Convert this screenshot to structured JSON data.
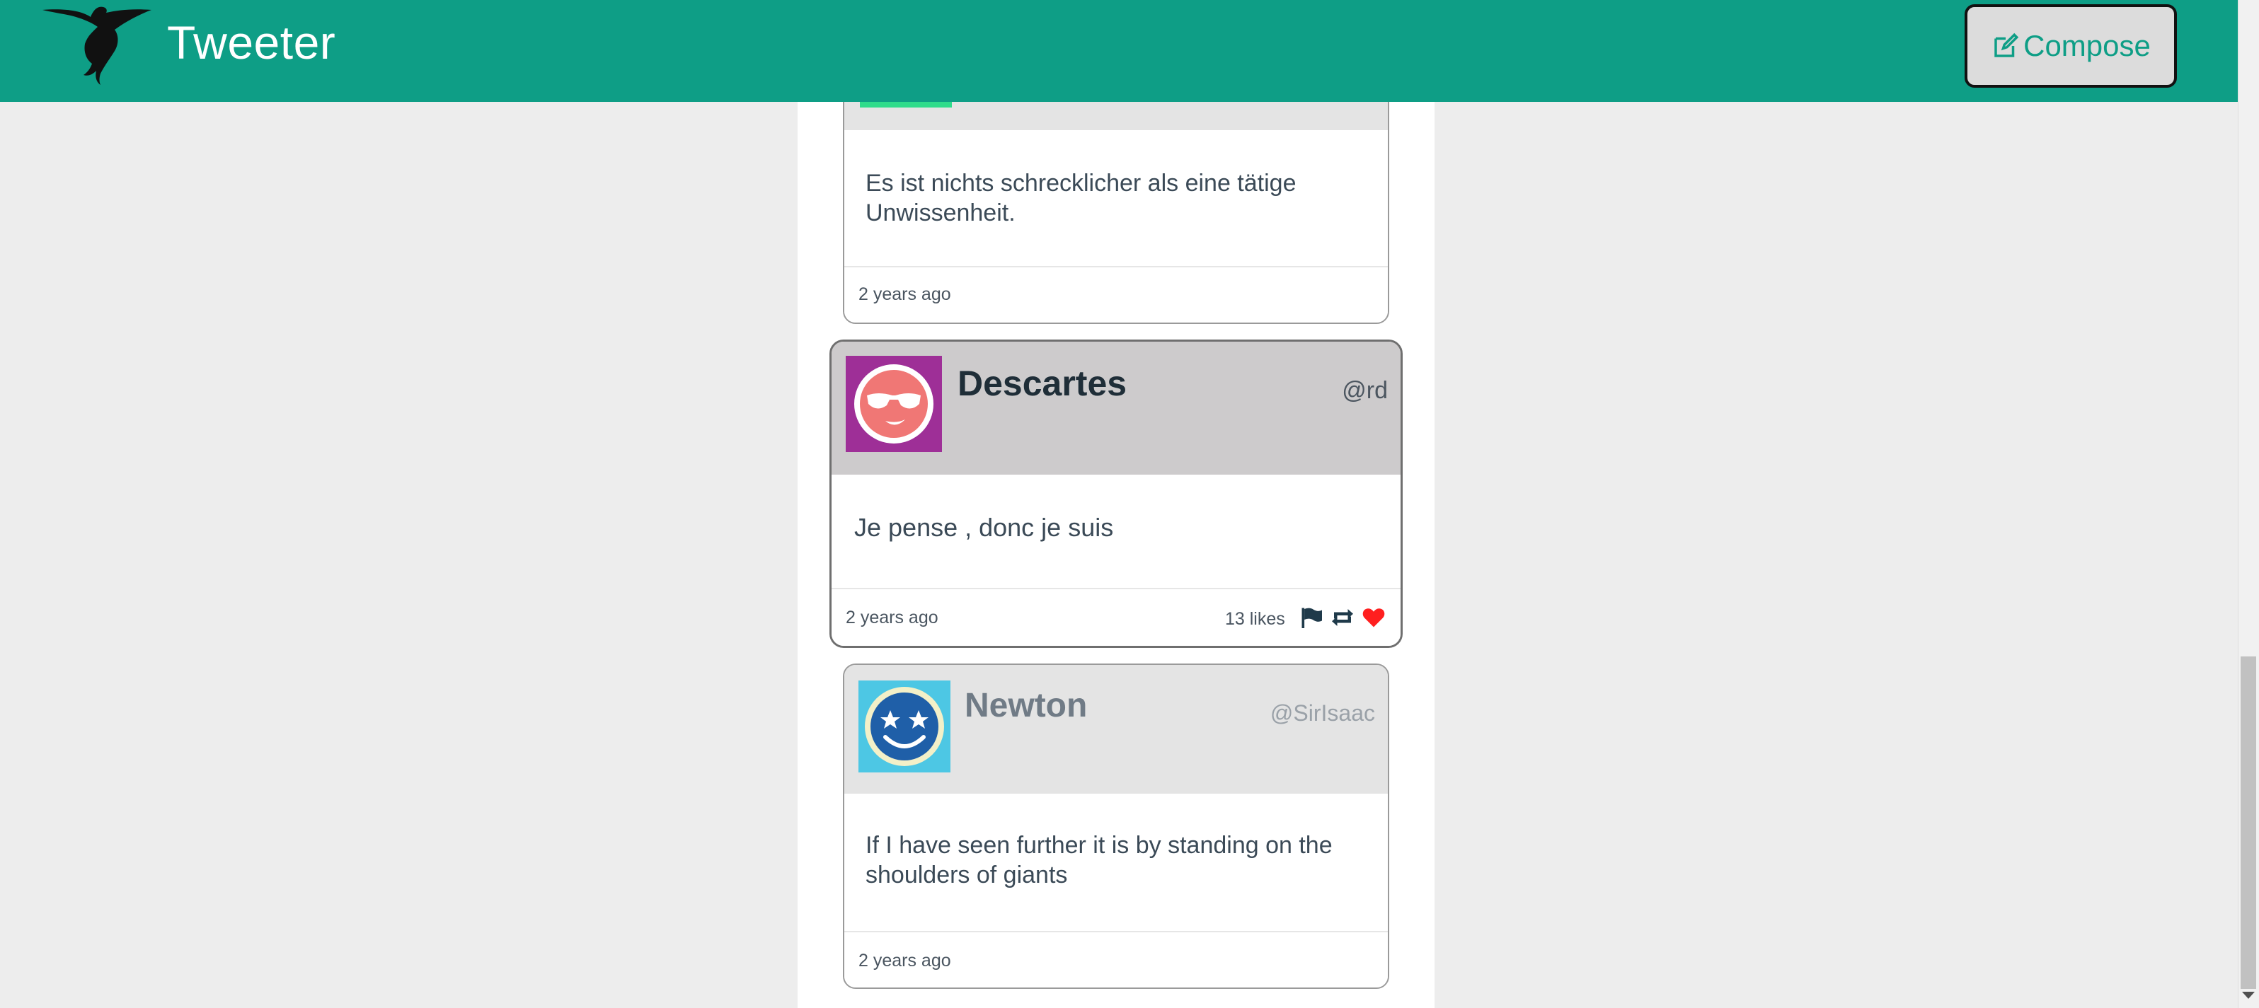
{
  "header": {
    "brand": "Tweeter",
    "logo_icon": "hummingbird-icon",
    "compose_label": "Compose",
    "compose_icon": "edit-icon"
  },
  "colors": {
    "header_bg": "#0e9e86",
    "accent": "#0e9e86",
    "like_red": "#ff1f1f",
    "page_bg": "#ededed"
  },
  "tweets": [
    {
      "text": "Es ist nichts schrecklicher als eine tätige Unwissenheit.",
      "time": "2 years ago"
    },
    {
      "name": "Descartes",
      "handle": "@rd",
      "text": "Je pense , donc je suis",
      "time": "2 years ago",
      "likes": "13 likes",
      "avatar_icon": "sunglasses-face-icon",
      "action_icons": [
        "flag-icon",
        "retweet-icon",
        "heart-icon"
      ]
    },
    {
      "name": "Newton",
      "handle": "@SirIsaac",
      "text": "If I have seen further it is by standing on the shoulders of giants",
      "time": "2 years ago",
      "avatar_icon": "star-eyes-face-icon"
    }
  ]
}
